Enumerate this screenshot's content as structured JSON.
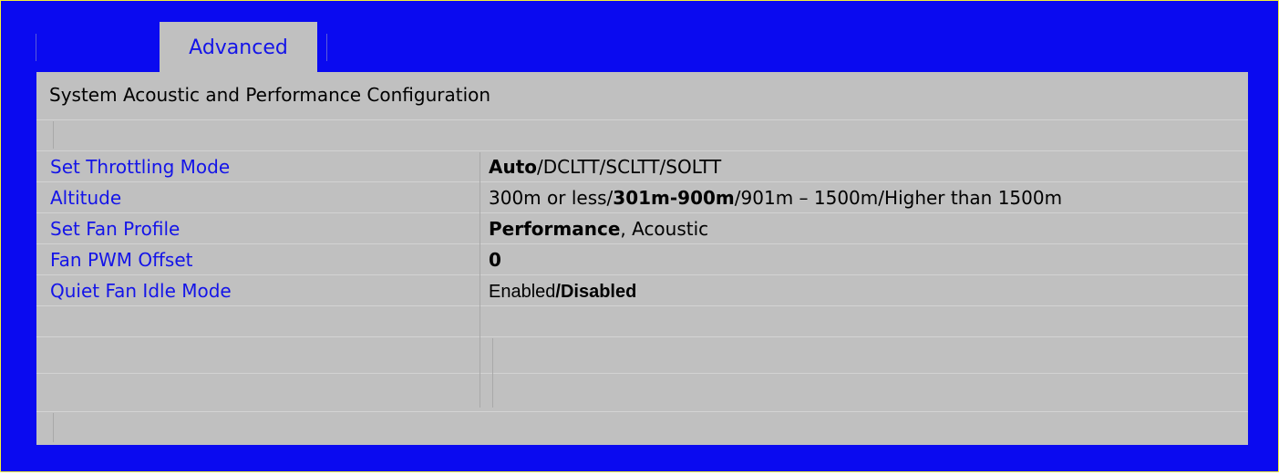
{
  "tabs": [
    {
      "label": "Advanced",
      "active": true
    }
  ],
  "section_title": "System Acoustic and Performance Configuration",
  "settings": [
    {
      "label": "Set Throttling Mode",
      "options": [
        {
          "text": "Auto",
          "selected": true
        },
        {
          "text": "/",
          "selected": false
        },
        {
          "text": "DCLTT",
          "selected": false
        },
        {
          "text": "/",
          "selected": false
        },
        {
          "text": "SCLTT",
          "selected": false
        },
        {
          "text": "/",
          "selected": false
        },
        {
          "text": "SOLTT",
          "selected": false
        }
      ]
    },
    {
      "label": "Altitude",
      "options": [
        {
          "text": "300m or less",
          "selected": false
        },
        {
          "text": "/",
          "selected": false
        },
        {
          "text": "301m-900m",
          "selected": true
        },
        {
          "text": "/",
          "selected": false
        },
        {
          "text": "901m – 1500m",
          "selected": false
        },
        {
          "text": "/",
          "selected": false
        },
        {
          "text": "Higher than 1500m",
          "selected": false
        }
      ]
    },
    {
      "label": "Set Fan Profile",
      "options": [
        {
          "text": "Performance",
          "selected": true
        },
        {
          "text": ", ",
          "selected": false
        },
        {
          "text": "Acoustic",
          "selected": false
        }
      ]
    },
    {
      "label": "Fan PWM Offset",
      "options": [
        {
          "text": "0",
          "selected": true
        }
      ]
    },
    {
      "label": "Quiet Fan Idle Mode",
      "options": [
        {
          "text": "Enabled",
          "selected": false
        },
        {
          "text": "/",
          "selected": true
        },
        {
          "text": "Disabled",
          "selected": true
        }
      ]
    }
  ],
  "colors": {
    "frame_background": "#0a0af0",
    "frame_border": "#f2ef3a",
    "panel_background": "#c0c0c0",
    "label_text": "#1414e8",
    "value_text": "#000000"
  }
}
